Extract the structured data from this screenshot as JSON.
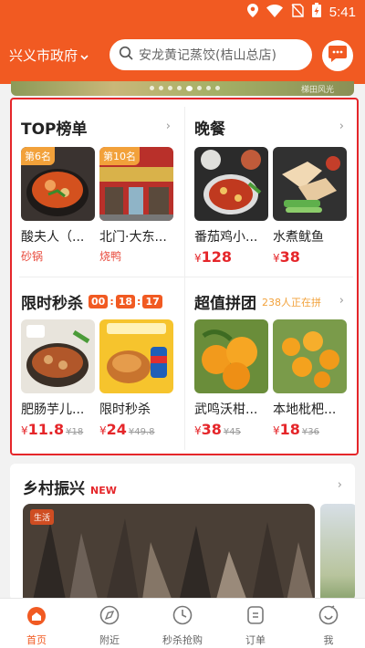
{
  "status": {
    "time": "5:41",
    "icons": [
      "location-icon",
      "wifi-icon",
      "no-sim-icon",
      "battery-charging-icon"
    ]
  },
  "header": {
    "city": "兴义市政府",
    "search_placeholder": "安龙黄记蒸饺(桔山总店)",
    "colors": {
      "brand": "#f15a22",
      "accent_red": "#e5262a",
      "badge": "#f2a13a"
    }
  },
  "banner": {
    "caption": "梯田风光",
    "dot_count": 8,
    "active_dot": 4
  },
  "sections": {
    "top": {
      "title": "TOP榜单",
      "items": [
        {
          "badge": "第6名",
          "name": "酸夫人（...",
          "category": "砂锅"
        },
        {
          "badge": "第10名",
          "name": "北门·大东...",
          "category": "烧鸭"
        }
      ]
    },
    "dinner": {
      "title": "晚餐",
      "items": [
        {
          "name": "番茄鸡小...",
          "price": "128"
        },
        {
          "name": "水煮鱿鱼",
          "price": "38"
        }
      ]
    },
    "flash": {
      "title": "限时秒杀",
      "timer": [
        "00",
        "18",
        "17"
      ],
      "items": [
        {
          "name": "肥肠芋儿...",
          "price": "11.8",
          "old_price": "18"
        },
        {
          "name": "限时秒杀",
          "price": "24",
          "old_price": "49.8"
        }
      ]
    },
    "group": {
      "title": "超值拼团",
      "count_text": "238人正在拼",
      "items": [
        {
          "name": "武鸣沃柑...",
          "price": "38",
          "old_price": "45"
        },
        {
          "name": "本地枇杷...",
          "price": "18",
          "old_price": "36"
        }
      ]
    }
  },
  "currency": "¥",
  "arrow": "›",
  "rural": {
    "title": "乡村振兴",
    "new_tag": "NEW",
    "image_logo": "生活"
  },
  "bottom_nav": [
    {
      "label": "首页",
      "icon": "home-icon",
      "active": true
    },
    {
      "label": "附近",
      "icon": "compass-icon",
      "active": false
    },
    {
      "label": "秒杀抢购",
      "icon": "clock-icon",
      "active": false
    },
    {
      "label": "订单",
      "icon": "order-icon",
      "active": false
    },
    {
      "label": "我",
      "icon": "profile-icon",
      "active": false
    }
  ]
}
